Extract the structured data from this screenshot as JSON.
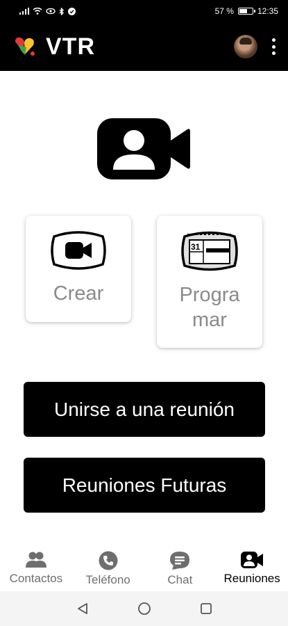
{
  "status_bar": {
    "battery": "57 %",
    "battery_level": 0.57,
    "time": "12:35"
  },
  "app_bar": {
    "title": "VTR",
    "logo_colors": [
      "#e53935",
      "#fbc02d",
      "#43a047"
    ]
  },
  "main": {
    "hero_icon": "video-contact-icon",
    "cards": [
      {
        "label": "Crear",
        "icon": "video-camera-icon"
      },
      {
        "label": "Progra\nmar",
        "icon": "calendar-icon",
        "calendar_day": "31"
      }
    ],
    "buttons": [
      {
        "label": "Unirse a una reunión"
      },
      {
        "label": "Reuniones Futuras"
      }
    ]
  },
  "bottom_nav": {
    "items": [
      {
        "label": "Contactos",
        "icon": "contacts-icon",
        "active": false
      },
      {
        "label": "Teléfono",
        "icon": "phone-icon",
        "active": false
      },
      {
        "label": "Chat",
        "icon": "chat-icon",
        "active": false
      },
      {
        "label": "Reuniones",
        "icon": "meeting-icon",
        "active": true
      }
    ]
  },
  "colors": {
    "bar": "#000000",
    "card_text": "#8a8a8a",
    "inactive_nav": "#6e6e6e"
  }
}
